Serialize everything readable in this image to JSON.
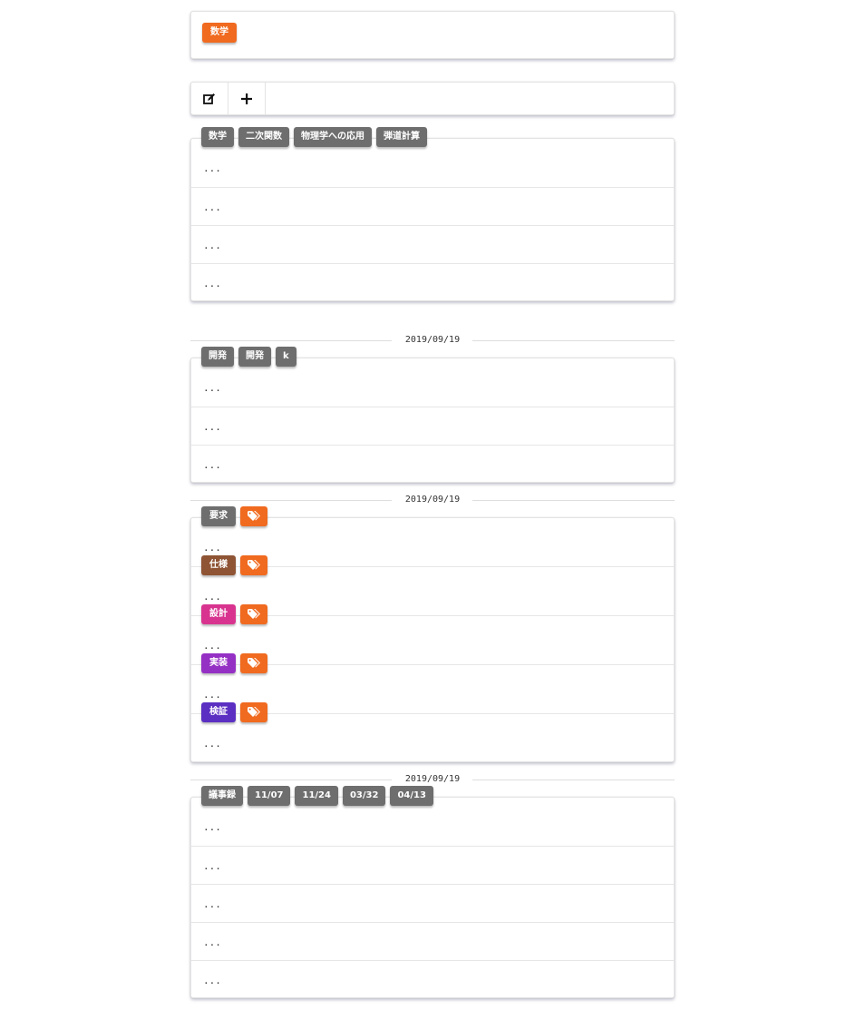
{
  "subject_panel": {
    "chip": "数学",
    "chip_color": "#f06a1f"
  },
  "toolbar": {
    "edit_icon": "edit-icon",
    "add_icon": "plus-icon"
  },
  "card1": {
    "tags": [
      "数学",
      "二次関数",
      "物理学への応用",
      "弾道計算"
    ],
    "rows": [
      "...",
      "...",
      "...",
      "..."
    ]
  },
  "card2": {
    "date": "2019/09/19",
    "tags": [
      "開発",
      "開発",
      "k"
    ],
    "rows": [
      "...",
      "...",
      "..."
    ]
  },
  "card3": {
    "date": "2019/09/19",
    "tag_icon": "tags-icon",
    "rows": [
      {
        "label": "要求",
        "color": "#6e6e6e",
        "text": "..."
      },
      {
        "label": "仕様",
        "color": "#8e5434",
        "text": "..."
      },
      {
        "label": "設計",
        "color": "#d8348f",
        "text": "..."
      },
      {
        "label": "実装",
        "color": "#9530c4",
        "text": "..."
      },
      {
        "label": "検証",
        "color": "#5b2fc2",
        "text": "..."
      }
    ]
  },
  "card4": {
    "date": "2019/09/19",
    "tags": [
      "議事録",
      "11/07",
      "11/24",
      "03/32",
      "04/13"
    ],
    "rows": [
      "...",
      "...",
      "...",
      "...",
      "..."
    ]
  }
}
